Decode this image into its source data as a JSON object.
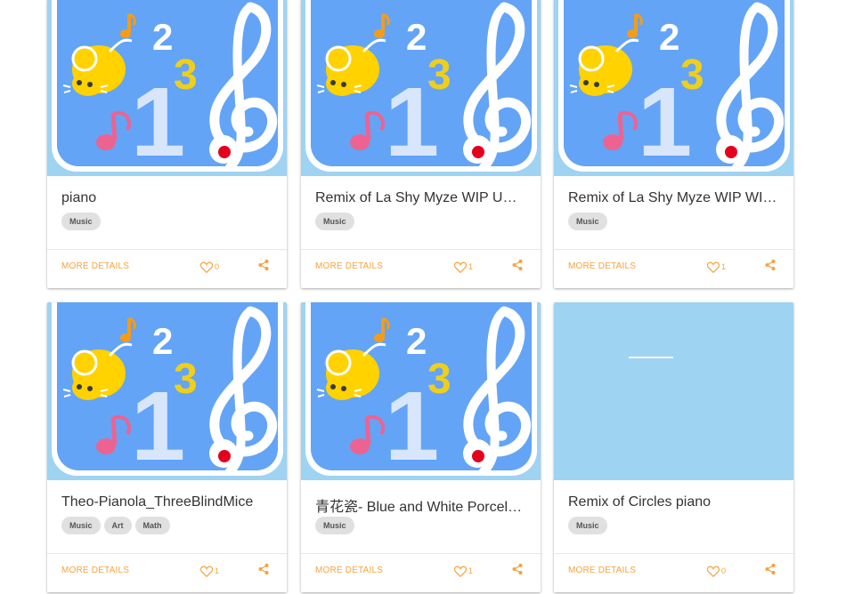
{
  "colors": {
    "accent": "#f6a33b",
    "thumb_bg": "#9ed3f2",
    "tile_blue": "#63a4f6",
    "mouse_yellow": "#ffd200",
    "note_pink": "#ec6392",
    "note_orange": "#f39c1b",
    "dot_red": "#e4001f",
    "tag_bg": "#e0e0e0"
  },
  "cards": [
    {
      "title": "piano",
      "tags": [
        "Music"
      ],
      "more_label": "MORE DETAILS",
      "likes": "0",
      "thumbnail": "music-app-icon"
    },
    {
      "title": "Remix of La Shy Myze WIP UPDATE",
      "tags": [
        "Music"
      ],
      "more_label": "MORE DETAILS",
      "likes": "1",
      "thumbnail": "music-app-icon"
    },
    {
      "title": "Remix of La Shy Myze WIP WITH",
      "tags": [
        "Music"
      ],
      "more_label": "MORE DETAILS",
      "likes": "1",
      "thumbnail": "music-app-icon"
    },
    {
      "title": "Theo-Pianola_ThreeBlindMice",
      "tags": [
        "Music",
        "Art",
        "Math"
      ],
      "more_label": "MORE DETAILS",
      "likes": "1",
      "thumbnail": "music-app-icon"
    },
    {
      "title": "青花瓷- Blue and White Porcelain",
      "tags": [
        "Music"
      ],
      "more_label": "MORE DETAILS",
      "likes": "1",
      "thumbnail": "music-app-icon"
    },
    {
      "title": "Remix of Circles piano",
      "tags": [
        "Music"
      ],
      "more_label": "MORE DETAILS",
      "likes": "0",
      "thumbnail": "loading-placeholder"
    }
  ]
}
